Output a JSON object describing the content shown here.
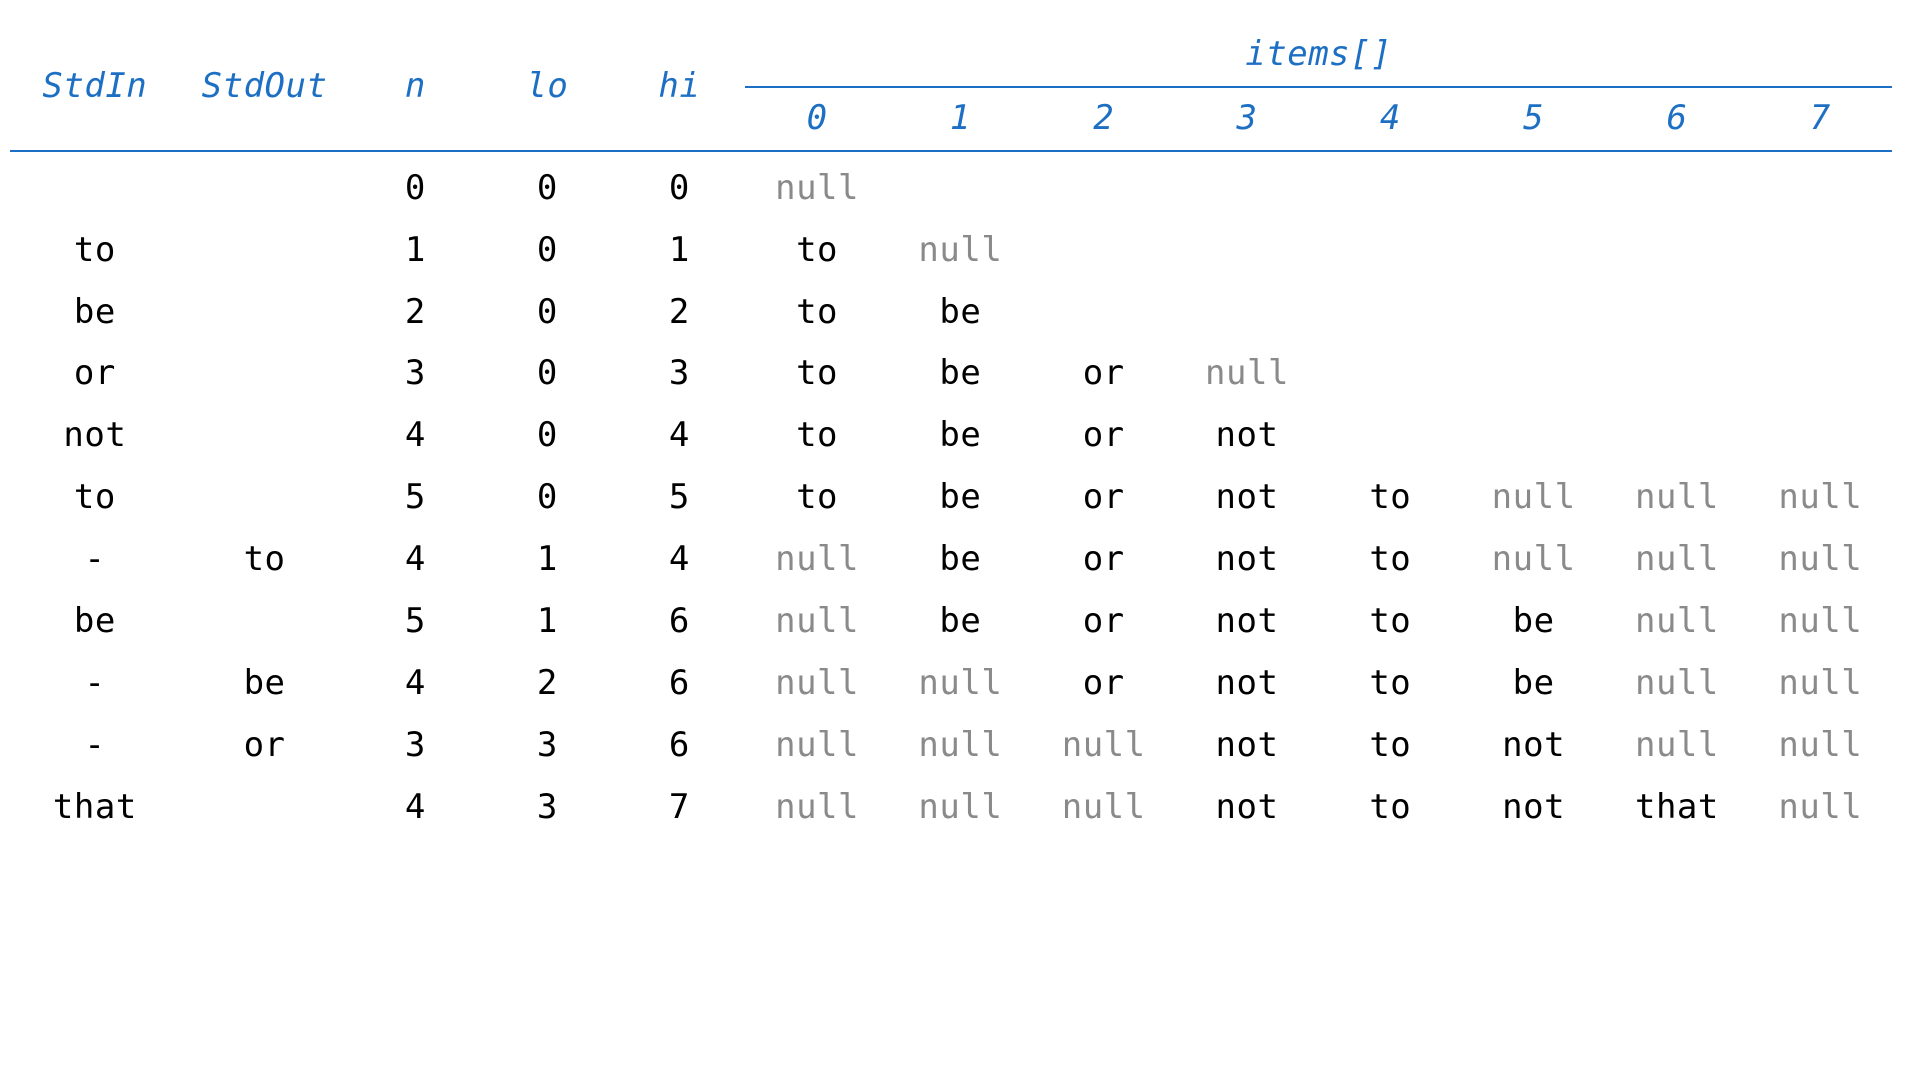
{
  "headers": {
    "stdin": "StdIn",
    "stdout": "StdOut",
    "n": "n",
    "lo": "lo",
    "hi": "hi",
    "items": "items[]",
    "indices": [
      "0",
      "1",
      "2",
      "3",
      "4",
      "5",
      "6",
      "7"
    ]
  },
  "rows": [
    {
      "stdin": "",
      "stdout": "",
      "n": "0",
      "lo": "0",
      "hi": "0",
      "items": [
        {
          "t": "null",
          "k": "null"
        },
        {
          "t": "",
          "k": "empty"
        },
        {
          "t": "",
          "k": "empty"
        },
        {
          "t": "",
          "k": "empty"
        },
        {
          "t": "",
          "k": "empty"
        },
        {
          "t": "",
          "k": "empty"
        },
        {
          "t": "",
          "k": "empty"
        },
        {
          "t": "",
          "k": "empty"
        }
      ]
    },
    {
      "stdin": "to",
      "stdout": "",
      "n": "1",
      "lo": "0",
      "hi": "1",
      "items": [
        {
          "t": "to",
          "k": "val"
        },
        {
          "t": "null",
          "k": "null"
        },
        {
          "t": "",
          "k": "empty"
        },
        {
          "t": "",
          "k": "empty"
        },
        {
          "t": "",
          "k": "empty"
        },
        {
          "t": "",
          "k": "empty"
        },
        {
          "t": "",
          "k": "empty"
        },
        {
          "t": "",
          "k": "empty"
        }
      ]
    },
    {
      "stdin": "be",
      "stdout": "",
      "n": "2",
      "lo": "0",
      "hi": "2",
      "items": [
        {
          "t": "to",
          "k": "val"
        },
        {
          "t": "be",
          "k": "val"
        },
        {
          "t": "",
          "k": "empty"
        },
        {
          "t": "",
          "k": "empty"
        },
        {
          "t": "",
          "k": "empty"
        },
        {
          "t": "",
          "k": "empty"
        },
        {
          "t": "",
          "k": "empty"
        },
        {
          "t": "",
          "k": "empty"
        }
      ]
    },
    {
      "stdin": "or",
      "stdout": "",
      "n": "3",
      "lo": "0",
      "hi": "3",
      "items": [
        {
          "t": "to",
          "k": "val"
        },
        {
          "t": "be",
          "k": "val"
        },
        {
          "t": "or",
          "k": "val"
        },
        {
          "t": "null",
          "k": "null"
        },
        {
          "t": "",
          "k": "empty"
        },
        {
          "t": "",
          "k": "empty"
        },
        {
          "t": "",
          "k": "empty"
        },
        {
          "t": "",
          "k": "empty"
        }
      ]
    },
    {
      "stdin": "not",
      "stdout": "",
      "n": "4",
      "lo": "0",
      "hi": "4",
      "items": [
        {
          "t": "to",
          "k": "val"
        },
        {
          "t": "be",
          "k": "val"
        },
        {
          "t": "or",
          "k": "val"
        },
        {
          "t": "not",
          "k": "val"
        },
        {
          "t": "",
          "k": "empty"
        },
        {
          "t": "",
          "k": "empty"
        },
        {
          "t": "",
          "k": "empty"
        },
        {
          "t": "",
          "k": "empty"
        }
      ]
    },
    {
      "stdin": "to",
      "stdout": "",
      "n": "5",
      "lo": "0",
      "hi": "5",
      "items": [
        {
          "t": "to",
          "k": "val"
        },
        {
          "t": "be",
          "k": "val"
        },
        {
          "t": "or",
          "k": "val"
        },
        {
          "t": "not",
          "k": "val"
        },
        {
          "t": "to",
          "k": "val"
        },
        {
          "t": "null",
          "k": "null"
        },
        {
          "t": "null",
          "k": "null"
        },
        {
          "t": "null",
          "k": "null"
        }
      ]
    },
    {
      "stdin": "-",
      "stdout": "to",
      "n": "4",
      "lo": "1",
      "hi": "4",
      "items": [
        {
          "t": "null",
          "k": "null"
        },
        {
          "t": "be",
          "k": "val"
        },
        {
          "t": "or",
          "k": "val"
        },
        {
          "t": "not",
          "k": "val"
        },
        {
          "t": "to",
          "k": "val"
        },
        {
          "t": "null",
          "k": "null"
        },
        {
          "t": "null",
          "k": "null"
        },
        {
          "t": "null",
          "k": "null"
        }
      ]
    },
    {
      "stdin": "be",
      "stdout": "",
      "n": "5",
      "lo": "1",
      "hi": "6",
      "items": [
        {
          "t": "null",
          "k": "null"
        },
        {
          "t": "be",
          "k": "val"
        },
        {
          "t": "or",
          "k": "val"
        },
        {
          "t": "not",
          "k": "val"
        },
        {
          "t": "to",
          "k": "val"
        },
        {
          "t": "be",
          "k": "val"
        },
        {
          "t": "null",
          "k": "null"
        },
        {
          "t": "null",
          "k": "null"
        }
      ]
    },
    {
      "stdin": "-",
      "stdout": "be",
      "n": "4",
      "lo": "2",
      "hi": "6",
      "items": [
        {
          "t": "null",
          "k": "null"
        },
        {
          "t": "null",
          "k": "null"
        },
        {
          "t": "or",
          "k": "val"
        },
        {
          "t": "not",
          "k": "val"
        },
        {
          "t": "to",
          "k": "val"
        },
        {
          "t": "be",
          "k": "val"
        },
        {
          "t": "null",
          "k": "null"
        },
        {
          "t": "null",
          "k": "null"
        }
      ]
    },
    {
      "stdin": "-",
      "stdout": "or",
      "n": "3",
      "lo": "3",
      "hi": "6",
      "items": [
        {
          "t": "null",
          "k": "null"
        },
        {
          "t": "null",
          "k": "null"
        },
        {
          "t": "null",
          "k": "null"
        },
        {
          "t": "not",
          "k": "val"
        },
        {
          "t": "to",
          "k": "val"
        },
        {
          "t": "not",
          "k": "val"
        },
        {
          "t": "null",
          "k": "null"
        },
        {
          "t": "null",
          "k": "null"
        }
      ]
    },
    {
      "stdin": "that",
      "stdout": "",
      "n": "4",
      "lo": "3",
      "hi": "7",
      "items": [
        {
          "t": "null",
          "k": "null"
        },
        {
          "t": "null",
          "k": "null"
        },
        {
          "t": "null",
          "k": "null"
        },
        {
          "t": "not",
          "k": "val"
        },
        {
          "t": "to",
          "k": "val"
        },
        {
          "t": "not",
          "k": "val"
        },
        {
          "t": "that",
          "k": "val"
        },
        {
          "t": "null",
          "k": "null"
        }
      ]
    }
  ]
}
